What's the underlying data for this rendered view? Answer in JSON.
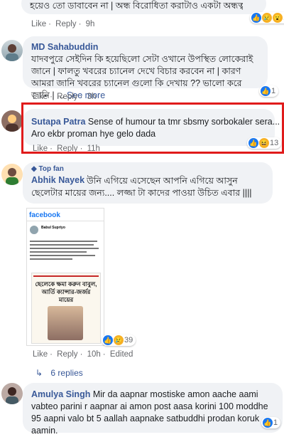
{
  "comments": [
    {
      "text": "হয়েও তো ডাবাবেন না | অন্ধ বিরোধিতা করাটাও একটা অন্ধত্ব 😥😥😥",
      "actions": {
        "like": "Like",
        "reply": "Reply",
        "time": "9h"
      },
      "reactions": {
        "count": "10"
      }
    },
    {
      "name": "MD Sahabuddin",
      "text": "যাদবপুরে সেইদিন কি হয়েছিলো সেটা ওখানে উপস্থিত লোকেরাই জানে | ফালতু খবরের চ্যানেল দেখে বিচার করবেন না | কারণ আমরা জানি খবরের চ্যানেল গুলো কি দেখায় ?? ভালো করে জানি | ...",
      "see_more": "See more",
      "actions": {
        "like": "Like",
        "reply": "Reply",
        "time": "3h"
      },
      "reactions": {
        "count": "1"
      }
    },
    {
      "name": "Sutapa Patra",
      "text1": "Sense of humour ta tmr sbsmy sorbokaler sera...",
      "text2": "Aro ekbr proman hye gelo dada",
      "actions": {
        "like": "Like",
        "reply": "Reply",
        "time": "11h"
      },
      "reactions": {
        "count": "13"
      }
    },
    {
      "badge": "Top fan",
      "name": "Abhik Nayek",
      "text": "উনি এগিয়ে এসেছেন আপনি এগিয়ে আসুন ছেলেটার মায়ের জন্য.... লজ্জা টা কাদের পাওয়া উচিত এবার ||||",
      "actions": {
        "like": "Like",
        "reply": "Reply",
        "time": "10h",
        "edited": "Edited"
      },
      "reactions": {
        "count": "39"
      },
      "replies": "6 replies",
      "embedded": {
        "logo": "facebook",
        "profile": "Babul Supriyo",
        "headline": "ছেলেকে ক্ষমা করুন বাবুল, আর্তি ক্যান্সার-জর্জর মায়ের"
      }
    },
    {
      "name": "Amulya Singh",
      "text": "Mir da aapnar mostiske amon aache aami vabteo parini r aapnar ai amon post aasa korini 100 moddhe 95 aapni valo bt 5 aallah aapnake satbuddhi prodan koruk aamin.",
      "reactions": {
        "count": "1"
      }
    }
  ],
  "colors": {
    "link": "#385898",
    "highlight": "#e01b1b",
    "bubble": "#f0f2f5",
    "like_blue": "#1877f2"
  }
}
